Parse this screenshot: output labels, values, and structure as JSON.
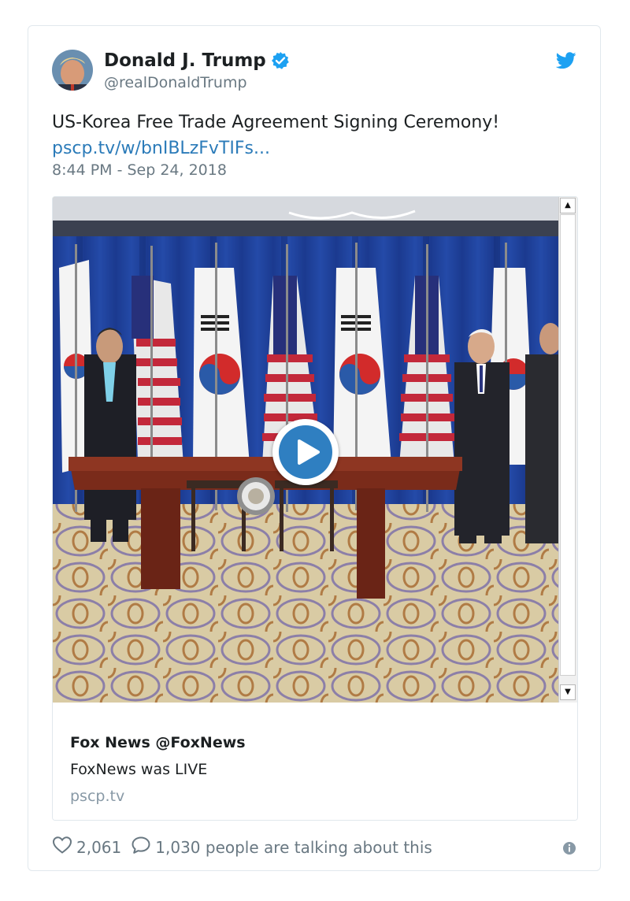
{
  "tweet": {
    "display_name": "Donald J. Trump",
    "handle": "@realDonaldTrump",
    "text": "US-Korea Free Trade Agreement Signing Ceremony!",
    "link": "pscp.tv/w/bnIBLzFvTIFs...",
    "timestamp": "8:44 PM - Sep 24, 2018"
  },
  "media_card": {
    "title": "Fox News @FoxNews",
    "subtitle": "FoxNews was LIVE",
    "domain": "pscp.tv"
  },
  "footer": {
    "likes": "2,061",
    "talking": "1,030 people are talking about this"
  },
  "icons": {
    "verified": "verified-badge-icon",
    "bird": "twitter-bird-icon",
    "play": "play-icon",
    "heart": "heart-icon",
    "comment": "comment-bubble-icon",
    "info": "info-icon"
  },
  "colors": {
    "link": "#2b7bb9",
    "verified": "#1da1f2",
    "play": "#2f7fc1",
    "muted": "#697882"
  }
}
